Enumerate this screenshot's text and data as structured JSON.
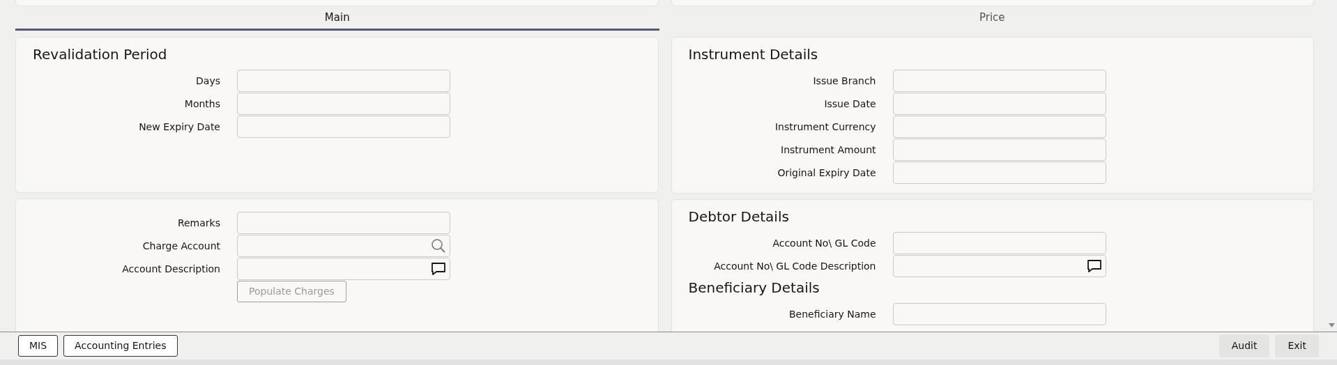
{
  "tabs": [
    {
      "label": "Main",
      "selected": true
    },
    {
      "label": "Price",
      "selected": false
    }
  ],
  "columns": [
    {
      "panels": [
        {
          "sections": [
            {
              "title": "Revalidation Period",
              "fields": [
                {
                  "label": "Days",
                  "kind": "text"
                },
                {
                  "label": "Months",
                  "kind": "text"
                },
                {
                  "label": "New Expiry Date",
                  "kind": "text"
                }
              ]
            }
          ]
        },
        {
          "sections": [
            {
              "fields": [
                {
                  "label": "Remarks",
                  "kind": "text"
                },
                {
                  "label": "Charge Account",
                  "kind": "lookup"
                },
                {
                  "label": "Account Description",
                  "kind": "note"
                }
              ],
              "buttons": [
                {
                  "label": "Populate Charges",
                  "disabled": true
                }
              ]
            }
          ]
        }
      ]
    },
    {
      "panels": [
        {
          "sections": [
            {
              "title": "Instrument Details",
              "fields": [
                {
                  "label": "Issue Branch",
                  "kind": "text"
                },
                {
                  "label": "Issue Date",
                  "kind": "text"
                },
                {
                  "label": "Instrument Currency",
                  "kind": "text"
                },
                {
                  "label": "Instrument Amount",
                  "kind": "text"
                },
                {
                  "label": "Original Expiry Date",
                  "kind": "text"
                }
              ]
            }
          ]
        },
        {
          "sections": [
            {
              "title": "Debtor Details",
              "fields": [
                {
                  "label": "Account No\\ GL Code",
                  "kind": "text"
                },
                {
                  "label": "Account No\\ GL Code Description",
                  "kind": "note"
                }
              ]
            },
            {
              "title": "Beneficiary Details",
              "fields": [
                {
                  "label": "Beneficiary Name",
                  "kind": "text"
                }
              ]
            }
          ]
        }
      ]
    }
  ],
  "footer": {
    "left_buttons": [
      {
        "label": "MIS"
      },
      {
        "label": "Accounting Entries"
      }
    ],
    "right_buttons": [
      {
        "label": "Audit"
      },
      {
        "label": "Exit"
      }
    ]
  }
}
